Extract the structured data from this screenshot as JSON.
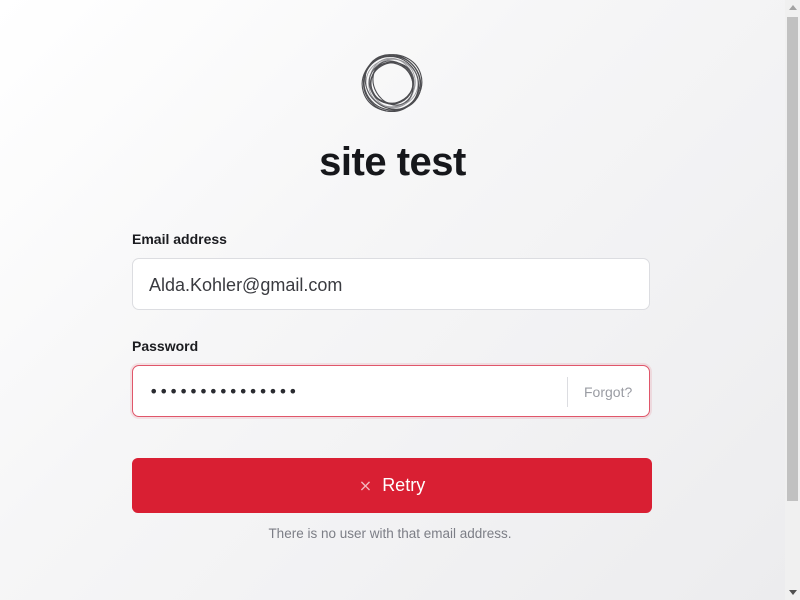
{
  "site": {
    "title": "site test"
  },
  "form": {
    "email_label": "Email address",
    "email_value": "Alda.Kohler@gmail.com",
    "password_label": "Password",
    "password_masked": "•••••••••••••••",
    "forgot_label": "Forgot?",
    "retry_icon": "×",
    "retry_label": "Retry",
    "error_message": "There is no user with that email address."
  },
  "colors": {
    "accent": "#d91f33",
    "error_border": "#e0566a"
  },
  "icons": {
    "logo": "ring-logo-icon",
    "retry": "close-icon",
    "scroll_up": "arrow-up-icon",
    "scroll_down": "arrow-down-icon"
  }
}
